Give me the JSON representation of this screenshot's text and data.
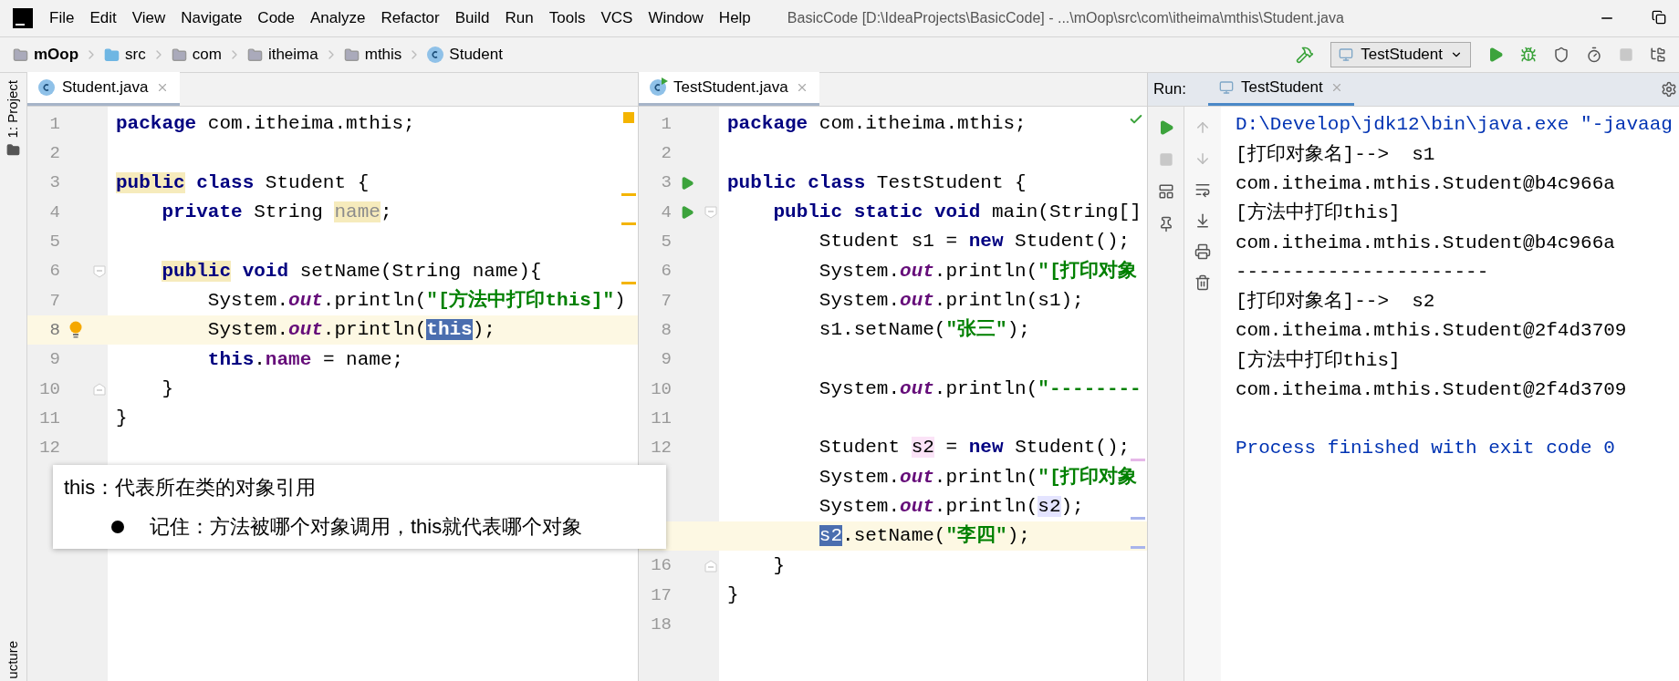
{
  "window": {
    "title": "BasicCode [D:\\IdeaProjects\\BasicCode] - ...\\mOop\\src\\com\\itheima\\mthis\\Student.java"
  },
  "menu": [
    "File",
    "Edit",
    "View",
    "Navigate",
    "Code",
    "Analyze",
    "Refactor",
    "Build",
    "Run",
    "Tools",
    "VCS",
    "Window",
    "Help"
  ],
  "breadcrumbs": [
    {
      "label": "mOop",
      "kind": "module"
    },
    {
      "label": "src",
      "kind": "source"
    },
    {
      "label": "com",
      "kind": "package"
    },
    {
      "label": "itheima",
      "kind": "package"
    },
    {
      "label": "mthis",
      "kind": "package"
    },
    {
      "label": "Student",
      "kind": "class"
    }
  ],
  "toolbar": {
    "run_config": "TestStudent",
    "stop_enabled": false
  },
  "tool_stripe": {
    "top": "1: Project",
    "bottom": "ucture"
  },
  "editors": [
    {
      "tab": {
        "label": "Student.java",
        "runnable": false
      },
      "marker": {
        "kind": "warning"
      },
      "lines": [
        {
          "number": "1",
          "current": false,
          "tokens": [
            {
              "text": "package",
              "kind": "keyword"
            },
            {
              "text": " com.itheima.mthis;",
              "kind": "plain"
            }
          ]
        },
        {
          "number": "2",
          "current": false
        },
        {
          "number": "3",
          "current": false,
          "stripe": {
            "color": "#f4b400"
          },
          "tokens": [
            {
              "text": "public",
              "kind": "keyword",
              "highlight": {
                "color": "#f6ebbc"
              }
            },
            {
              "text": " class",
              "kind": "keyword"
            },
            {
              "text": " Student {",
              "kind": "plain"
            }
          ]
        },
        {
          "number": "4",
          "current": false,
          "stripe": {
            "color": "#f4b400"
          },
          "tokens": [
            {
              "text": "    private",
              "kind": "keyword"
            },
            {
              "text": " String",
              "kind": "plain"
            },
            {
              "text": " name",
              "kind": "muted",
              "highlight": {
                "color": "#f6ebbc"
              }
            },
            {
              "text": ";",
              "kind": "plain"
            }
          ]
        },
        {
          "number": "5",
          "current": false
        },
        {
          "number": "6",
          "current": false,
          "stripe": {
            "color": "#f4b400"
          },
          "gutter": [
            {
              "kind": "fold-start"
            }
          ],
          "tokens": [
            {
              "text": "    public",
              "kind": "keyword",
              "highlight": {
                "color": "#f6ebbc"
              }
            },
            {
              "text": " void",
              "kind": "keyword"
            },
            {
              "text": " setName(String name){",
              "kind": "plain"
            }
          ]
        },
        {
          "number": "7",
          "current": false,
          "tokens": [
            {
              "text": "        System.",
              "kind": "plain"
            },
            {
              "text": "out",
              "kind": "static"
            },
            {
              "text": ".println(",
              "kind": "plain"
            },
            {
              "text": "\"[方法中打印this]\"",
              "kind": "string"
            },
            {
              "text": ")",
              "kind": "plain"
            }
          ]
        },
        {
          "number": "8",
          "current": true,
          "gutter": [
            {
              "kind": "bulb"
            }
          ],
          "tokens": [
            {
              "text": "        System.",
              "kind": "plain"
            },
            {
              "text": "out",
              "kind": "static"
            },
            {
              "text": ".println(",
              "kind": "plain"
            },
            {
              "text": "this",
              "kind": "keyword",
              "highlight": {
                "color": "#4b6eaf"
              }
            },
            {
              "text": ");",
              "kind": "plain"
            }
          ]
        },
        {
          "number": "9",
          "current": false,
          "tokens": [
            {
              "text": "        this",
              "kind": "keyword"
            },
            {
              "text": ".",
              "kind": "plain"
            },
            {
              "text": "name",
              "kind": "field"
            },
            {
              "text": " = name;",
              "kind": "plain"
            }
          ]
        },
        {
          "number": "10",
          "current": false,
          "gutter": [
            {
              "kind": "fold-end"
            }
          ],
          "tokens": [
            {
              "text": "    }",
              "kind": "plain"
            }
          ]
        },
        {
          "number": "11",
          "current": false,
          "tokens": [
            {
              "text": "}",
              "kind": "plain"
            }
          ]
        },
        {
          "number": "12",
          "current": false
        }
      ]
    },
    {
      "tab": {
        "label": "TestStudent.java",
        "runnable": true
      },
      "marker": {
        "kind": "ok"
      },
      "lines": [
        {
          "number": "1",
          "current": false,
          "tokens": [
            {
              "text": "package",
              "kind": "keyword"
            },
            {
              "text": " com.itheima.mthis;",
              "kind": "plain"
            }
          ]
        },
        {
          "number": "2",
          "current": false
        },
        {
          "number": "3",
          "current": false,
          "gutter": [
            {
              "kind": "run"
            }
          ],
          "tokens": [
            {
              "text": "public",
              "kind": "keyword"
            },
            {
              "text": " class",
              "kind": "keyword"
            },
            {
              "text": " TestStudent {",
              "kind": "plain"
            }
          ]
        },
        {
          "number": "4",
          "current": false,
          "gutter": [
            {
              "kind": "run"
            },
            {
              "kind": "fold-start"
            }
          ],
          "tokens": [
            {
              "text": "    public",
              "kind": "keyword"
            },
            {
              "text": " static",
              "kind": "keyword"
            },
            {
              "text": " void",
              "kind": "keyword"
            },
            {
              "text": " main(String[]",
              "kind": "plain"
            }
          ]
        },
        {
          "number": "5",
          "current": false,
          "tokens": [
            {
              "text": "        Student s1 =",
              "kind": "plain"
            },
            {
              "text": " new",
              "kind": "keyword"
            },
            {
              "text": " Student();",
              "kind": "plain"
            }
          ]
        },
        {
          "number": "6",
          "current": false,
          "tokens": [
            {
              "text": "        System.",
              "kind": "plain"
            },
            {
              "text": "out",
              "kind": "static"
            },
            {
              "text": ".println(",
              "kind": "plain"
            },
            {
              "text": "\"[打印对象",
              "kind": "string"
            }
          ]
        },
        {
          "number": "7",
          "current": false,
          "tokens": [
            {
              "text": "        System.",
              "kind": "plain"
            },
            {
              "text": "out",
              "kind": "static"
            },
            {
              "text": ".println(s1);",
              "kind": "plain"
            }
          ]
        },
        {
          "number": "8",
          "current": false,
          "tokens": [
            {
              "text": "        s1.setName(",
              "kind": "plain"
            },
            {
              "text": "\"张三\"",
              "kind": "string"
            },
            {
              "text": ");",
              "kind": "plain"
            }
          ]
        },
        {
          "number": "9",
          "current": false
        },
        {
          "number": "10",
          "current": false,
          "tokens": [
            {
              "text": "        System.",
              "kind": "plain"
            },
            {
              "text": "out",
              "kind": "static"
            },
            {
              "text": ".println(",
              "kind": "plain"
            },
            {
              "text": "\"--------",
              "kind": "string"
            }
          ]
        },
        {
          "number": "11",
          "current": false
        },
        {
          "number": "12",
          "current": false,
          "stripe": {
            "color": "#e6b8e8"
          },
          "tokens": [
            {
              "text": "        Student",
              "kind": "plain"
            },
            {
              "text": " s2",
              "kind": "plain",
              "highlight": {
                "color": "#fbe3f7"
              }
            },
            {
              "text": " =",
              "kind": "plain"
            },
            {
              "text": " new",
              "kind": "keyword"
            },
            {
              "text": " Student();",
              "kind": "plain"
            }
          ]
        },
        {
          "current": false,
          "tokens": [
            {
              "text": "        System.",
              "kind": "plain"
            },
            {
              "text": "out",
              "kind": "static"
            },
            {
              "text": ".println(",
              "kind": "plain"
            },
            {
              "text": "\"[打印对象",
              "kind": "string"
            }
          ]
        },
        {
          "current": false,
          "stripe": {
            "color": "#a8b4ec"
          },
          "tokens": [
            {
              "text": "        System.",
              "kind": "plain"
            },
            {
              "text": "out",
              "kind": "static"
            },
            {
              "text": ".println(",
              "kind": "plain"
            },
            {
              "text": "s2",
              "kind": "plain",
              "highlight": {
                "color": "#e4e4ff"
              }
            },
            {
              "text": ");",
              "kind": "plain"
            }
          ]
        },
        {
          "current": true,
          "stripe": {
            "color": "#a8b4ec"
          },
          "tokens": [
            {
              "text": "        s2",
              "kind": "plain",
              "highlight": {
                "color": "#4b6eaf"
              }
            },
            {
              "text": ".setName(",
              "kind": "plain"
            },
            {
              "text": "\"李四\"",
              "kind": "string"
            },
            {
              "text": ");",
              "kind": "plain"
            }
          ]
        },
        {
          "number": "16",
          "current": false,
          "gutter": [
            {
              "kind": "fold-end"
            }
          ],
          "tokens": [
            {
              "text": "    }",
              "kind": "plain"
            }
          ]
        },
        {
          "number": "17",
          "current": false,
          "tokens": [
            {
              "text": "}",
              "kind": "plain"
            }
          ]
        },
        {
          "number": "18",
          "current": false
        }
      ]
    }
  ],
  "run_panel": {
    "label": "Run:",
    "tab": "TestStudent",
    "stop_enabled": false,
    "console": [
      {
        "kind": "cmd",
        "text": "D:\\Develop\\jdk12\\bin\\java.exe \"-javaag"
      },
      {
        "kind": "out",
        "text": "[打印对象名]-->  s1"
      },
      {
        "kind": "out",
        "text": "com.itheima.mthis.Student@b4c966a"
      },
      {
        "kind": "out",
        "text": "[方法中打印this]"
      },
      {
        "kind": "out",
        "text": "com.itheima.mthis.Student@b4c966a"
      },
      {
        "kind": "out",
        "text": "----------------------"
      },
      {
        "kind": "out",
        "text": "[打印对象名]-->  s2"
      },
      {
        "kind": "out",
        "text": "com.itheima.mthis.Student@2f4d3709"
      },
      {
        "kind": "out",
        "text": "[方法中打印this]"
      },
      {
        "kind": "out",
        "text": "com.itheima.mthis.Student@2f4d3709"
      },
      {
        "kind": "exit",
        "text": "Process finished with exit code 0"
      }
    ]
  },
  "note": {
    "title": "this：代表所在类的对象引用",
    "bullets": [
      "记住：方法被哪个对象调用，this就代表哪个对象"
    ]
  }
}
